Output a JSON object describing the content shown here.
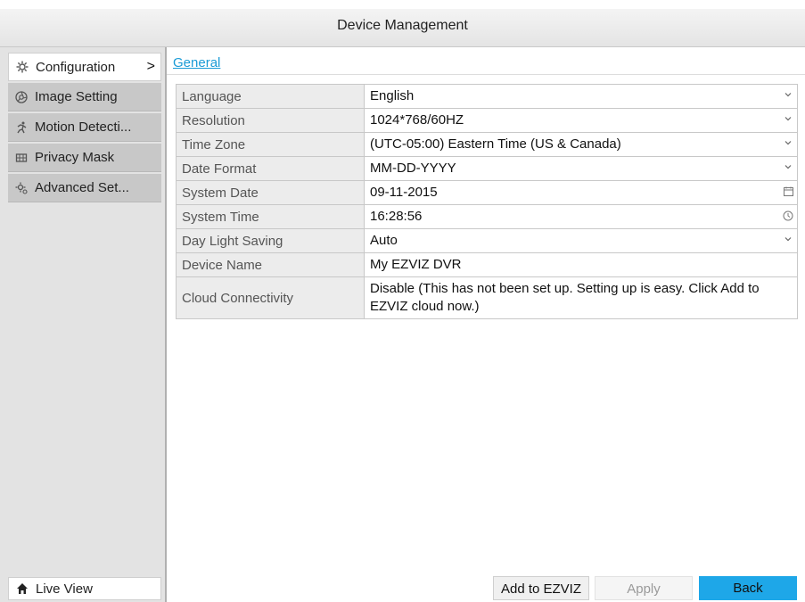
{
  "window": {
    "title": "Device Management"
  },
  "sidebar": {
    "items": [
      {
        "label": "Configuration",
        "icon": "gear-icon",
        "active": true
      },
      {
        "label": "Image Setting",
        "icon": "aperture-icon",
        "active": false
      },
      {
        "label": "Motion Detecti...",
        "icon": "running-figure-icon",
        "active": false
      },
      {
        "label": "Privacy Mask",
        "icon": "mask-grid-icon",
        "active": false
      },
      {
        "label": "Advanced Set...",
        "icon": "advanced-gear-icon",
        "active": false
      }
    ],
    "active_indicator": ">",
    "live_view": {
      "label": "Live View",
      "icon": "home-icon"
    }
  },
  "tabs": [
    {
      "label": "General",
      "active": true
    }
  ],
  "settings": [
    {
      "label": "Language",
      "value": "English",
      "control": "dropdown"
    },
    {
      "label": "Resolution",
      "value": "1024*768/60HZ",
      "control": "dropdown"
    },
    {
      "label": "Time Zone",
      "value": "(UTC-05:00) Eastern Time (US & Canada)",
      "control": "dropdown"
    },
    {
      "label": "Date Format",
      "value": "MM-DD-YYYY",
      "control": "dropdown"
    },
    {
      "label": "System Date",
      "value": "09-11-2015",
      "control": "calendar"
    },
    {
      "label": "System Time",
      "value": "16:28:56",
      "control": "clock"
    },
    {
      "label": "Day Light Saving",
      "value": "Auto",
      "control": "dropdown"
    },
    {
      "label": "Device Name",
      "value": "My EZVIZ DVR",
      "control": "text"
    },
    {
      "label": "Cloud Connectivity",
      "value": "Disable (This has not been set up. Setting up is easy. Click Add to EZVIZ cloud now.)",
      "control": "static"
    }
  ],
  "buttons": {
    "add_to_ezviz": "Add to EZVIZ",
    "apply": "Apply",
    "back": "Back"
  },
  "colors": {
    "accent": "#1ea7e8",
    "link": "#1a9bd6",
    "sidebar_bg": "#e3e3e3",
    "label_cell_bg": "#ececec"
  }
}
